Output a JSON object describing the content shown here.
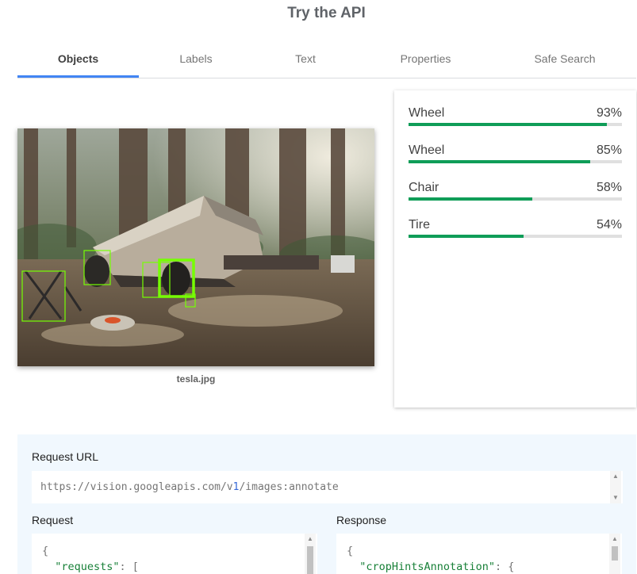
{
  "page": {
    "title": "Try the API"
  },
  "tabs": [
    {
      "label": "Objects",
      "active": true
    },
    {
      "label": "Labels",
      "active": false
    },
    {
      "label": "Text",
      "active": false
    },
    {
      "label": "Properties",
      "active": false
    },
    {
      "label": "Safe Search",
      "active": false
    }
  ],
  "image": {
    "filename": "tesla.jpg",
    "detection_box_count": 5,
    "box_color": "#76ff03"
  },
  "results": [
    {
      "label": "Wheel",
      "score": "93%",
      "fraction": 0.93
    },
    {
      "label": "Wheel",
      "score": "85%",
      "fraction": 0.85
    },
    {
      "label": "Chair",
      "score": "58%",
      "fraction": 0.58
    },
    {
      "label": "Tire",
      "score": "54%",
      "fraction": 0.54
    }
  ],
  "request_url": {
    "label": "Request URL",
    "prefix": "https://vision.googleapis.com/v",
    "version": "1",
    "suffix": "/images:annotate"
  },
  "request": {
    "label": "Request",
    "line1": "{",
    "key": "\"requests\"",
    "rest": ": ["
  },
  "response": {
    "label": "Response",
    "line1": "{",
    "key": "\"cropHintsAnnotation\"",
    "rest": ": {"
  },
  "colors": {
    "accent": "#4285f4",
    "score_bar": "#0f9d58",
    "panel_bg": "#f1f8fe",
    "json_key": "#188038"
  },
  "icons": {
    "scroll_up": "▲",
    "scroll_down": "▼"
  }
}
